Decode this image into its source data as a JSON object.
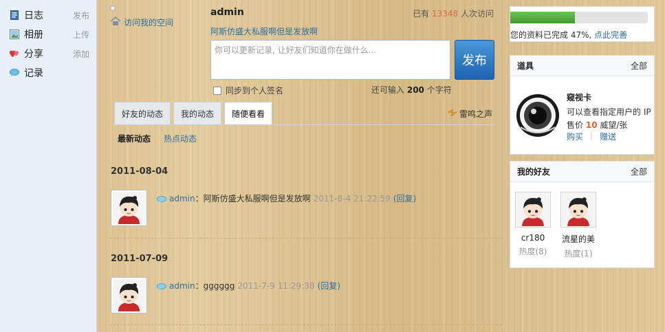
{
  "sidebar": {
    "items": [
      {
        "label": "日志",
        "action": "发布"
      },
      {
        "label": "相册",
        "action": "上传"
      },
      {
        "label": "分享",
        "action": "添加"
      },
      {
        "label": "记录",
        "action": ""
      }
    ]
  },
  "main": {
    "visit_link": "访问我的空间",
    "username": "admin",
    "visits_prefix": "已有",
    "visits_count": "13348",
    "visits_suffix": "人次访问",
    "current_status": "阿斯仿盛大私服啊但是发放啊",
    "post_placeholder": "你可以更新记录, 让好友们知道你在做什么...",
    "publish_label": "发布",
    "sync_label": "同步到个人签名",
    "remain_prefix": "还可输入",
    "remain_count": "200",
    "remain_suffix": "个字符",
    "tabs": [
      {
        "label": "好友的动态"
      },
      {
        "label": "我的动态"
      },
      {
        "label": "随便看看"
      }
    ],
    "leiming_label": "雷鸣之声",
    "subtabs": {
      "latest": "最新动态",
      "hot": "热点动态"
    },
    "feed": [
      {
        "date": "2011-08-04",
        "user": "admin",
        "text": "阿斯仿盛大私服啊但是发放啊",
        "time": "2011-8-4 21:22:59",
        "reply": "(回复)"
      },
      {
        "date": "2011-07-09",
        "user": "admin",
        "text": "gggggg",
        "time": "2011-7-9 11:29:38",
        "reply": "(回复)"
      }
    ]
  },
  "profile": {
    "progress_percent": 47,
    "progress_text": "您的资料已完成 47%,",
    "progress_link": "点此完善"
  },
  "props": {
    "title": "道具",
    "all": "全部",
    "item_name": "窥视卡",
    "item_desc": "可以查看指定用户的 IP",
    "price_prefix": "售价",
    "price_value": "10",
    "price_suffix": "威望/张",
    "buy": "购买",
    "gift": "赠送"
  },
  "friends": {
    "title": "我的好友",
    "all": "全部",
    "list": [
      {
        "name": "cr180",
        "heat": "热度(8)"
      },
      {
        "name": "流星的美",
        "heat": "热度(1)"
      }
    ]
  },
  "colors": {
    "accent": "#2c6ea5",
    "count": "#e06a4b",
    "progress": "#4caf3a",
    "publish": "#2a78c8"
  }
}
